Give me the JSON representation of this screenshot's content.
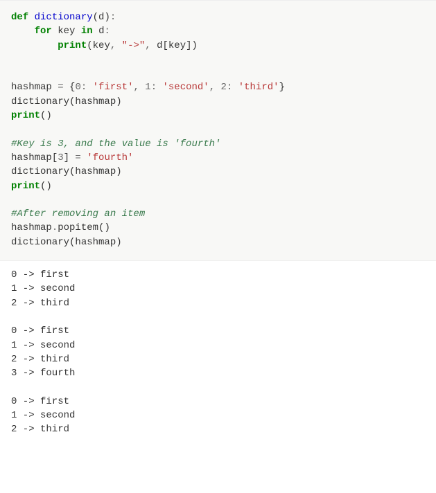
{
  "code": {
    "l1": {
      "def": "def",
      "name": "dictionary",
      "lp": "(",
      "arg": "d",
      "rp": ")",
      "colon": ":"
    },
    "l2": {
      "indent": "    ",
      "for": "for",
      "var": "key",
      "in": "in",
      "iter": "d",
      "colon": ":"
    },
    "l3": {
      "indent": "        ",
      "print": "print",
      "lp": "(",
      "a1": "key",
      "c1": ", ",
      "s1": "\"->\"",
      "c2": ", ",
      "a3a": "d",
      "lb": "[",
      "a3b": "key",
      "rb": "]",
      "rp": ")"
    },
    "l5": {
      "lhs": "hashmap",
      "eq": " = ",
      "lb": "{",
      "k0": "0",
      "c0": ": ",
      "v0": "'first'",
      "s0": ", ",
      "k1": "1",
      "c1": ": ",
      "v1": "'second'",
      "s1": ", ",
      "k2": "2",
      "c2": ": ",
      "v2": "'third'",
      "rb": "}"
    },
    "l6": {
      "fn": "dictionary",
      "lp": "(",
      "arg": "hashmap",
      "rp": ")"
    },
    "l7": {
      "print": "print",
      "lp": "(",
      "rp": ")"
    },
    "l9": {
      "text": "#Key is 3, and the value is 'fourth'"
    },
    "l10": {
      "lhs": "hashmap",
      "lb": "[",
      "idx": "3",
      "rb": "]",
      "eq": " = ",
      "val": "'fourth'"
    },
    "l11": {
      "fn": "dictionary",
      "lp": "(",
      "arg": "hashmap",
      "rp": ")"
    },
    "l12": {
      "print": "print",
      "lp": "(",
      "rp": ")"
    },
    "l14": {
      "text": "#After removing an item"
    },
    "l15": {
      "obj": "hashmap",
      "dot": ".",
      "meth": "popitem",
      "lp": "(",
      "rp": ")"
    },
    "l16": {
      "fn": "dictionary",
      "lp": "(",
      "arg": "hashmap",
      "rp": ")"
    }
  },
  "output": {
    "b1": {
      "r0": "0 -> first",
      "r1": "1 -> second",
      "r2": "2 -> third"
    },
    "b2": {
      "r0": "0 -> first",
      "r1": "1 -> second",
      "r2": "2 -> third",
      "r3": "3 -> fourth"
    },
    "b3": {
      "r0": "0 -> first",
      "r1": "1 -> second",
      "r2": "2 -> third"
    }
  }
}
